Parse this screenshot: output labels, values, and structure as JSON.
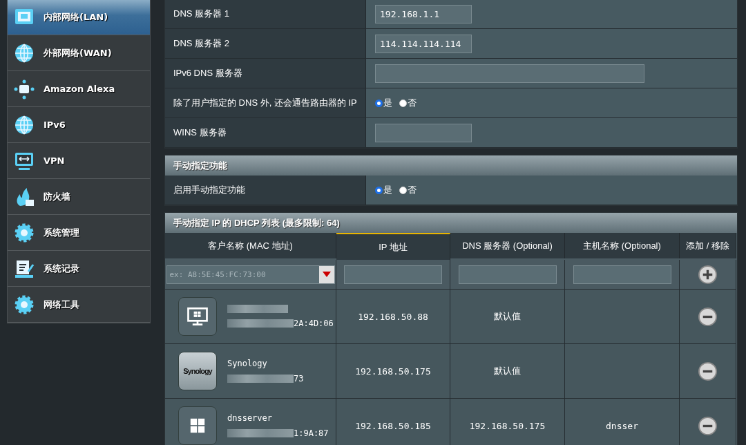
{
  "sidebar": {
    "items": [
      {
        "label": "内部网络(LAN)",
        "selected": true
      },
      {
        "label": "外部网络(WAN)",
        "selected": false
      },
      {
        "label": "Amazon Alexa",
        "selected": false
      },
      {
        "label": "IPv6",
        "selected": false
      },
      {
        "label": "VPN",
        "selected": false
      },
      {
        "label": "防火墙",
        "selected": false
      },
      {
        "label": "系统管理",
        "selected": false
      },
      {
        "label": "系统记录",
        "selected": false
      },
      {
        "label": "网络工具",
        "selected": false
      }
    ]
  },
  "dns_settings": {
    "rows": [
      {
        "label": "DNS 服务器 1",
        "kind": "field",
        "value": "192.168.1.1"
      },
      {
        "label": "DNS 服务器 2",
        "kind": "field",
        "value": "114.114.114.114"
      },
      {
        "label": "IPv6 DNS 服务器",
        "kind": "field"
      },
      {
        "label": "除了用户指定的 DNS 外, 还会通告路由器的 IP",
        "kind": "radio",
        "choices": [
          {
            "label": "是",
            "selected": true
          },
          {
            "label": "否",
            "selected": false
          }
        ]
      },
      {
        "label": "WINS 服务器",
        "kind": "field"
      }
    ]
  },
  "manual_section": {
    "title": "手动指定功能",
    "rows": [
      {
        "label": "启用手动指定功能",
        "kind": "radio",
        "choices": [
          {
            "label": "是",
            "selected": true
          },
          {
            "label": "否",
            "selected": false
          }
        ]
      }
    ]
  },
  "dhcp_list": {
    "title": "手动指定 IP 的 DHCP 列表 (最多限制: 64)",
    "columns": [
      "客户名称 (MAC 地址)",
      "IP 地址",
      "DNS 服务器 (Optional)",
      "主机名称 (Optional)",
      "添加 / 移除"
    ],
    "new_entry": {
      "mac_placeholder": "ex: A8:5E:45:FC:73:00"
    },
    "rows": [
      {
        "mac": "2A:4D:06",
        "ip": "192.168.50.88",
        "dns": "默认值"
      },
      {
        "logo_text": "Synology",
        "name": "Synology",
        "mac": "73",
        "ip": "192.168.50.175",
        "dns": "默认值"
      },
      {
        "name": "dnsserver",
        "mac": "1:9A:87",
        "ip": "192.168.50.185",
        "dns": "192.168.50.175",
        "hostname": "dnsser"
      }
    ]
  }
}
